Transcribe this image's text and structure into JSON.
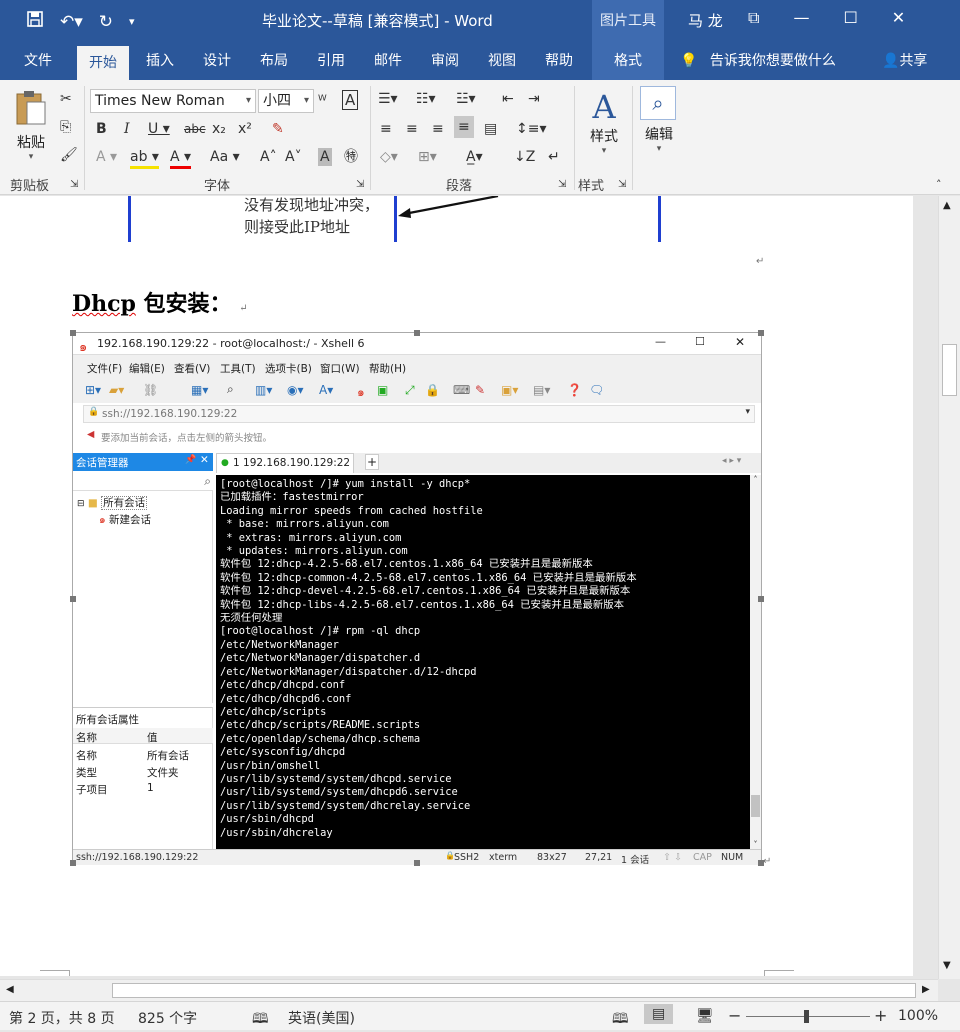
{
  "titlebar": {
    "title": "毕业论文--草稿 [兼容模式]  -  Word",
    "context_tools": "图片工具",
    "user": "马 龙"
  },
  "tabs": [
    "文件",
    "开始",
    "插入",
    "设计",
    "布局",
    "引用",
    "邮件",
    "审阅",
    "视图",
    "帮助",
    "格式"
  ],
  "tell_me": "告诉我你想要做什么",
  "share": "共享",
  "ribbon": {
    "paste_label": "粘贴",
    "font_name": "Times New Roman",
    "font_size": "小四",
    "styles_label": "样式",
    "edit_label": "编辑",
    "groups": [
      "剪贴板",
      "字体",
      "段落",
      "样式"
    ]
  },
  "document": {
    "figure_text_line1": "没有发现地址冲突，",
    "figure_text_line2": "则接受此IP地址",
    "heading_word": "Dhcp",
    "heading_rest": " 包安装：",
    "return_mark": "↵"
  },
  "xshell": {
    "title": "192.168.190.129:22 - root@localhost:/ - Xshell 6",
    "menu": [
      "文件(F)",
      "编辑(E)",
      "查看(V)",
      "工具(T)",
      "选项卡(B)",
      "窗口(W)",
      "帮助(H)"
    ],
    "address": "ssh://192.168.190.129:22",
    "hint": "要添加当前会话，点击左侧的箭头按钮。",
    "session_manager": "会话管理器",
    "session_tab": "1 192.168.190.129:22",
    "tree_root": "所有会话",
    "tree_child": "新建会话",
    "props_title": "所有会话属性",
    "props_headers": [
      "名称",
      "值"
    ],
    "props_rows": [
      [
        "名称",
        "所有会话"
      ],
      [
        "类型",
        "文件夹"
      ],
      [
        "子项目",
        "1"
      ]
    ],
    "terminal_lines": [
      "[root@localhost /]# yum install -y dhcp*",
      "已加载插件：fastestmirror",
      "Loading mirror speeds from cached hostfile",
      " * base: mirrors.aliyun.com",
      " * extras: mirrors.aliyun.com",
      " * updates: mirrors.aliyun.com",
      "软件包 12:dhcp-4.2.5-68.el7.centos.1.x86_64 已安装并且是最新版本",
      "软件包 12:dhcp-common-4.2.5-68.el7.centos.1.x86_64 已安装并且是最新版本",
      "软件包 12:dhcp-devel-4.2.5-68.el7.centos.1.x86_64 已安装并且是最新版本",
      "软件包 12:dhcp-libs-4.2.5-68.el7.centos.1.x86_64 已安装并且是最新版本",
      "无须任何处理",
      "[root@localhost /]# rpm -ql dhcp",
      "/etc/NetworkManager",
      "/etc/NetworkManager/dispatcher.d",
      "/etc/NetworkManager/dispatcher.d/12-dhcpd",
      "/etc/dhcp/dhcpd.conf",
      "/etc/dhcp/dhcpd6.conf",
      "/etc/dhcp/scripts",
      "/etc/dhcp/scripts/README.scripts",
      "/etc/openldap/schema/dhcp.schema",
      "/etc/sysconfig/dhcpd",
      "/usr/bin/omshell",
      "/usr/lib/systemd/system/dhcpd.service",
      "/usr/lib/systemd/system/dhcpd6.service",
      "/usr/lib/systemd/system/dhcrelay.service",
      "/usr/sbin/dhcpd",
      "/usr/sbin/dhcrelay"
    ],
    "status": {
      "address": "ssh://192.168.190.129:22",
      "protocol": "SSH2",
      "term": "xterm",
      "size": "83x27",
      "cursor": "27,21",
      "sessions": "1 会话",
      "caps": "CAP",
      "num": "NUM"
    }
  },
  "statusbar": {
    "page": "第 2 页，共 8 页",
    "words": "825 个字",
    "language": "英语(美国)",
    "zoom": "100%"
  },
  "colors": {
    "word_blue": "#2b579a",
    "accent_context": "#3e6bb0",
    "figure_line": "#1f3fd0"
  }
}
